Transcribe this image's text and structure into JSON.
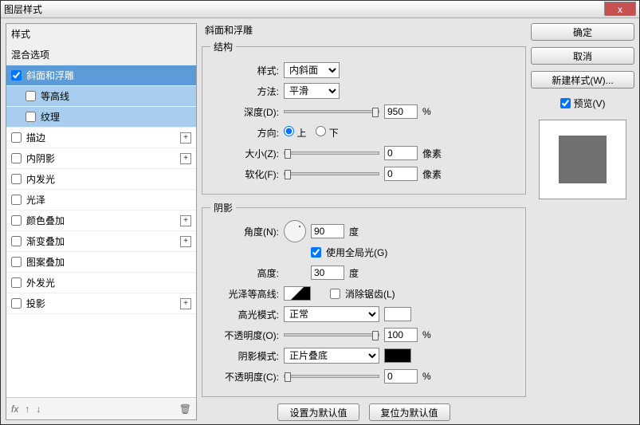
{
  "window": {
    "title": "图层样式",
    "close": "x"
  },
  "sidebar": {
    "header1": "样式",
    "header2": "混合选项",
    "items": [
      {
        "label": "斜面和浮雕",
        "checked": true,
        "selected": true
      },
      {
        "label": "等高线",
        "sub": true
      },
      {
        "label": "纹理",
        "sub": true
      },
      {
        "label": "描边",
        "add": true
      },
      {
        "label": "内阴影",
        "add": true
      },
      {
        "label": "内发光"
      },
      {
        "label": "光泽"
      },
      {
        "label": "颜色叠加",
        "add": true
      },
      {
        "label": "渐变叠加",
        "add": true
      },
      {
        "label": "图案叠加"
      },
      {
        "label": "外发光"
      },
      {
        "label": "投影",
        "add": true
      }
    ],
    "footer": {
      "fx": "fx",
      "trash": "🗑"
    }
  },
  "panel": {
    "title": "斜面和浮雕",
    "structure": {
      "legend": "结构",
      "style_label": "样式:",
      "style_value": "内斜面",
      "technique_label": "方法:",
      "technique_value": "平滑",
      "depth_label": "深度(D):",
      "depth_value": "950",
      "depth_unit": "%",
      "direction_label": "方向:",
      "up": "上",
      "down": "下",
      "size_label": "大小(Z):",
      "size_value": "0",
      "size_unit": "像素",
      "soften_label": "软化(F):",
      "soften_value": "0",
      "soften_unit": "像素"
    },
    "shading": {
      "legend": "阴影",
      "angle_label": "角度(N):",
      "angle_value": "90",
      "angle_unit": "度",
      "global_label": "使用全局光(G)",
      "altitude_label": "高度:",
      "altitude_value": "30",
      "altitude_unit": "度",
      "gloss_label": "光泽等高线:",
      "antialias_label": "消除锯齿(L)",
      "highlight_mode_label": "高光模式:",
      "highlight_mode_value": "正常",
      "highlight_opacity_label": "不透明度(O):",
      "highlight_opacity_value": "100",
      "highlight_opacity_unit": "%",
      "shadow_mode_label": "阴影模式:",
      "shadow_mode_value": "正片叠底",
      "shadow_opacity_label": "不透明度(C):",
      "shadow_opacity_value": "0",
      "shadow_opacity_unit": "%"
    },
    "buttons": {
      "make_default": "设置为默认值",
      "reset_default": "复位为默认值"
    }
  },
  "side": {
    "ok": "确定",
    "cancel": "取消",
    "new_style": "新建样式(W)...",
    "preview_label": "预览(V)"
  }
}
